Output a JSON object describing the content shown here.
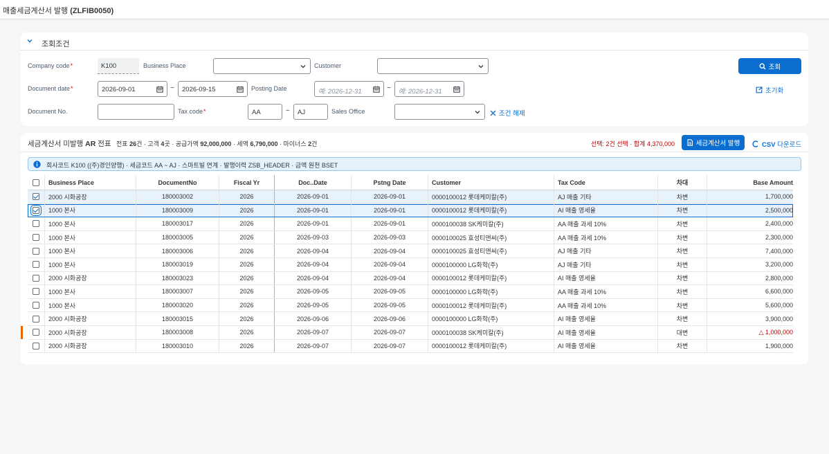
{
  "page": {
    "title_prefix": "매출세금계산서 발행 ",
    "title_code": "(ZLFIB0050)"
  },
  "filters": {
    "section_label": "조회조건",
    "company_code_label": "Company code",
    "company_code_value": "K100",
    "business_place_label": "Business Place",
    "customer_label": "Customer",
    "document_date_label": "Document date",
    "document_date_from": "2026-09-01",
    "document_date_to": "2026-09-15",
    "range_sep": "~",
    "posting_date_label": "Posting Date",
    "posting_date_from_placeholder": "예: 2026-12-31",
    "posting_date_to_placeholder": "예: 2026-12-31",
    "document_no_label": "Document No.",
    "tax_code_label": "Tax code",
    "tax_code_from": "AA",
    "tax_code_to": "AJ",
    "sales_office_label": "Sales Office",
    "clear_label": "조건 해제",
    "search_label": "조회",
    "reset_label": "초기화"
  },
  "table_toolbar": {
    "title_prefix": "세금계산서 미발행 ",
    "title_bold": "AR",
    "title_suffix": " 전표",
    "stats": [
      {
        "label": "전표 ",
        "value": "26",
        "unit": "건 · "
      },
      {
        "label": "고객 ",
        "value": "4",
        "unit": "곳 · "
      },
      {
        "label": "공급가액 ",
        "value": "92,000,000",
        "unit": " · "
      },
      {
        "label": "세액 ",
        "value": "6,790,000",
        "unit": " · "
      },
      {
        "label": "마이너스 ",
        "value": "2",
        "unit": "건"
      }
    ],
    "selection_summary": "선택: 2건 선택 · 합계 4,370,000",
    "issue_label": "세금계산서 발행",
    "csv_label": "CSV 다운로드"
  },
  "info_strip": "회사코드 K100 ((주)경인양행) · 세금코드 AA ~ AJ · 스마트빌 연계 · 발행이력 ZSB_HEADER · 금액 원천 BSET",
  "columns": [
    "Business Place",
    "DocumentNo",
    "Fiscal Yr",
    "Doc..Date",
    "Pstng Date",
    "Customer",
    "Tax Code",
    "차대",
    "Base Amount"
  ],
  "rows": [
    {
      "bp": "2000 시화공장",
      "doc": "180003002",
      "fy": "2026",
      "docdate": "2026-09-01",
      "pdate": "2026-09-01",
      "cust": "0000100012 롯데케미칼(주)",
      "tax": "AJ 매출 기타",
      "dc": "차변",
      "amt": "1,700,000",
      "checked": true,
      "neg": false
    },
    {
      "bp": "1000 본사",
      "doc": "180003009",
      "fy": "2026",
      "docdate": "2026-09-01",
      "pdate": "2026-09-01",
      "cust": "0000100012 롯데케미칼(주)",
      "tax": "AI 매출 영세율",
      "dc": "차변",
      "amt": "2,500,000",
      "checked": true,
      "neg": false
    },
    {
      "bp": "1000 본사",
      "doc": "180003017",
      "fy": "2026",
      "docdate": "2026-09-01",
      "pdate": "2026-09-01",
      "cust": "0000100038 SK케미칼(주)",
      "tax": "AA 매출 과세 10%",
      "dc": "차변",
      "amt": "2,400,000",
      "checked": false,
      "neg": false
    },
    {
      "bp": "1000 본사",
      "doc": "180003005",
      "fy": "2026",
      "docdate": "2026-09-03",
      "pdate": "2026-09-03",
      "cust": "0000100025 효성티앤씨(주)",
      "tax": "AA 매출 과세 10%",
      "dc": "차변",
      "amt": "2,300,000",
      "checked": false,
      "neg": false
    },
    {
      "bp": "1000 본사",
      "doc": "180003006",
      "fy": "2026",
      "docdate": "2026-09-04",
      "pdate": "2026-09-04",
      "cust": "0000100025 효성티앤씨(주)",
      "tax": "AJ 매출 기타",
      "dc": "차변",
      "amt": "7,400,000",
      "checked": false,
      "neg": false
    },
    {
      "bp": "1000 본사",
      "doc": "180003019",
      "fy": "2026",
      "docdate": "2026-09-04",
      "pdate": "2026-09-04",
      "cust": "0000100000 LG화학(주)",
      "tax": "AJ 매출 기타",
      "dc": "차변",
      "amt": "3,200,000",
      "checked": false,
      "neg": false
    },
    {
      "bp": "2000 시화공장",
      "doc": "180003023",
      "fy": "2026",
      "docdate": "2026-09-04",
      "pdate": "2026-09-04",
      "cust": "0000100012 롯데케미칼(주)",
      "tax": "AI 매출 영세율",
      "dc": "차변",
      "amt": "2,800,000",
      "checked": false,
      "neg": false
    },
    {
      "bp": "1000 본사",
      "doc": "180003007",
      "fy": "2026",
      "docdate": "2026-09-05",
      "pdate": "2026-09-05",
      "cust": "0000100000 LG화학(주)",
      "tax": "AA 매출 과세 10%",
      "dc": "차변",
      "amt": "6,600,000",
      "checked": false,
      "neg": false
    },
    {
      "bp": "1000 본사",
      "doc": "180003020",
      "fy": "2026",
      "docdate": "2026-09-05",
      "pdate": "2026-09-05",
      "cust": "0000100012 롯데케미칼(주)",
      "tax": "AA 매출 과세 10%",
      "dc": "차변",
      "amt": "5,600,000",
      "checked": false,
      "neg": false
    },
    {
      "bp": "2000 시화공장",
      "doc": "180003015",
      "fy": "2026",
      "docdate": "2026-09-06",
      "pdate": "2026-09-06",
      "cust": "0000100000 LG화학(주)",
      "tax": "AI 매출 영세율",
      "dc": "차변",
      "amt": "3,900,000",
      "checked": false,
      "neg": false
    },
    {
      "bp": "2000 시화공장",
      "doc": "180003008",
      "fy": "2026",
      "docdate": "2026-09-07",
      "pdate": "2026-09-07",
      "cust": "0000100038 SK케미칼(주)",
      "tax": "AI 매출 영세율",
      "dc": "대변",
      "amt": "△ 1,000,000",
      "checked": false,
      "neg": true
    },
    {
      "bp": "2000 시화공장",
      "doc": "180003010",
      "fy": "2026",
      "docdate": "2026-09-07",
      "pdate": "2026-09-07",
      "cust": "0000100012 롯데케미칼(주)",
      "tax": "AI 매출 영세율",
      "dc": "차변",
      "amt": "1,900,000",
      "checked": false,
      "neg": false
    }
  ],
  "colors": {
    "accent": "#0a6ed1",
    "negative": "#bb0000",
    "marker": "#e76500"
  }
}
